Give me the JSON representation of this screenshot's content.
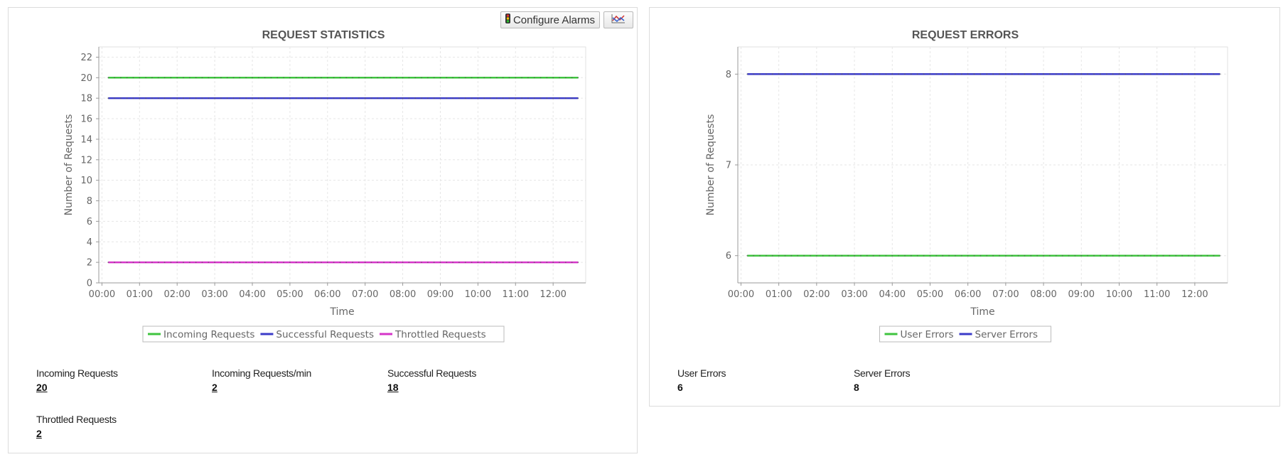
{
  "toolbar": {
    "configure_alarms_label": "Configure Alarms",
    "alarm_icon": "traffic-light-icon",
    "chart_icon": "line-chart-icon"
  },
  "chart_data": [
    {
      "type": "line",
      "title": "REQUEST STATISTICS",
      "xlabel": "Time",
      "ylabel": "Number of Requests",
      "x_ticks": [
        "00:00",
        "01:00",
        "02:00",
        "03:00",
        "04:00",
        "05:00",
        "06:00",
        "07:00",
        "08:00",
        "09:00",
        "10:00",
        "11:00",
        "12:00"
      ],
      "x_start": "00:10",
      "x_end": "12:40",
      "ylim": [
        0,
        23
      ],
      "y_ticks": [
        0,
        2,
        4,
        6,
        8,
        10,
        12,
        14,
        16,
        18,
        20,
        22
      ],
      "grid": true,
      "legend_position": "bottom",
      "series": [
        {
          "name": "Incoming Requests",
          "color": "#3ec43e",
          "values": [
            20,
            20
          ]
        },
        {
          "name": "Successful Requests",
          "color": "#3b3bc8",
          "values": [
            18,
            18
          ]
        },
        {
          "name": "Throttled Requests",
          "color": "#d534c8",
          "values": [
            2,
            2
          ]
        }
      ]
    },
    {
      "type": "line",
      "title": "REQUEST ERRORS",
      "xlabel": "Time",
      "ylabel": "Number of Requests",
      "x_ticks": [
        "00:00",
        "01:00",
        "02:00",
        "03:00",
        "04:00",
        "05:00",
        "06:00",
        "07:00",
        "08:00",
        "09:00",
        "10:00",
        "11:00",
        "12:00"
      ],
      "x_start": "00:10",
      "x_end": "12:40",
      "ylim": [
        5.7,
        8.3
      ],
      "y_ticks": [
        6,
        7,
        8
      ],
      "grid": true,
      "legend_position": "bottom",
      "series": [
        {
          "name": "User Errors",
          "color": "#3ec43e",
          "values": [
            6,
            6
          ]
        },
        {
          "name": "Server Errors",
          "color": "#3b3bc8",
          "values": [
            8,
            8
          ]
        }
      ]
    }
  ],
  "stats_left": [
    {
      "label": "Incoming Requests",
      "value": "20",
      "link": true
    },
    {
      "label": "Incoming Requests/min",
      "value": "2",
      "link": true
    },
    {
      "label": "Successful Requests",
      "value": "18",
      "link": true
    },
    {
      "label": "Throttled Requests",
      "value": "2",
      "link": true
    }
  ],
  "stats_right": [
    {
      "label": "User Errors",
      "value": "6",
      "link": false
    },
    {
      "label": "Server Errors",
      "value": "8",
      "link": false
    }
  ]
}
